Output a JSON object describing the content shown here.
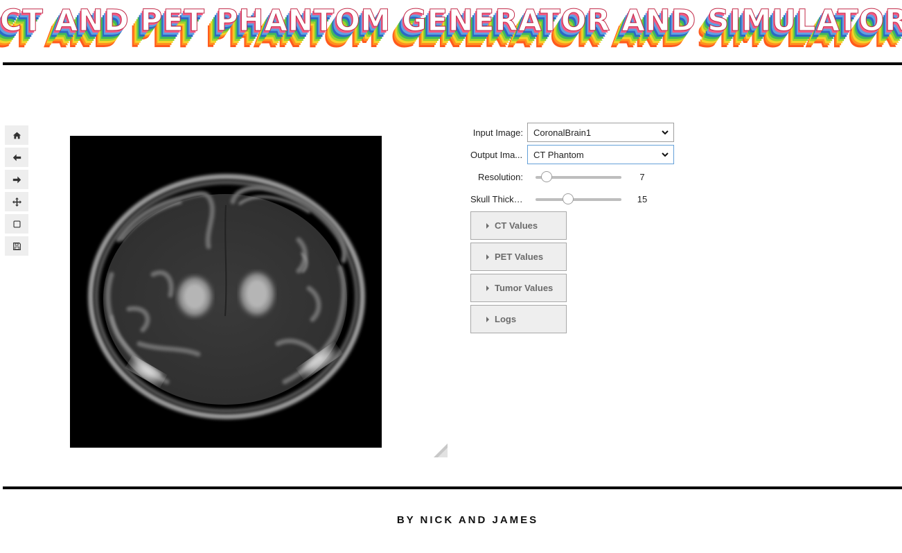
{
  "header": {
    "title": "CT AND PET PHANTOM GENERATOR AND SIMULATOR"
  },
  "toolbar": {
    "items": [
      {
        "icon": "home-icon"
      },
      {
        "icon": "arrow-left-icon"
      },
      {
        "icon": "arrow-right-icon"
      },
      {
        "icon": "move-icon"
      },
      {
        "icon": "zoom-rect-icon"
      },
      {
        "icon": "save-icon"
      }
    ]
  },
  "controls": {
    "input_image": {
      "label": "Input Image:",
      "value": "CoronalBrain1"
    },
    "output_image": {
      "label": "Output Ima...",
      "value": "CT Phantom"
    },
    "resolution": {
      "label": "Resolution:",
      "value": "7",
      "level": 0.13
    },
    "skull_thickness": {
      "label": "Skull Thickn...",
      "value": "15",
      "level": 0.38
    }
  },
  "accordions": {
    "ct_values": "CT Values",
    "pet_values": "PET Values",
    "tumor_values": "Tumor Values",
    "logs": "Logs"
  },
  "footer": {
    "credit": "BY NICK AND JAMES"
  },
  "colors": {
    "focus_border": "#64a0d8",
    "panel_bg": "#eeeeee",
    "rule": "#000000"
  }
}
